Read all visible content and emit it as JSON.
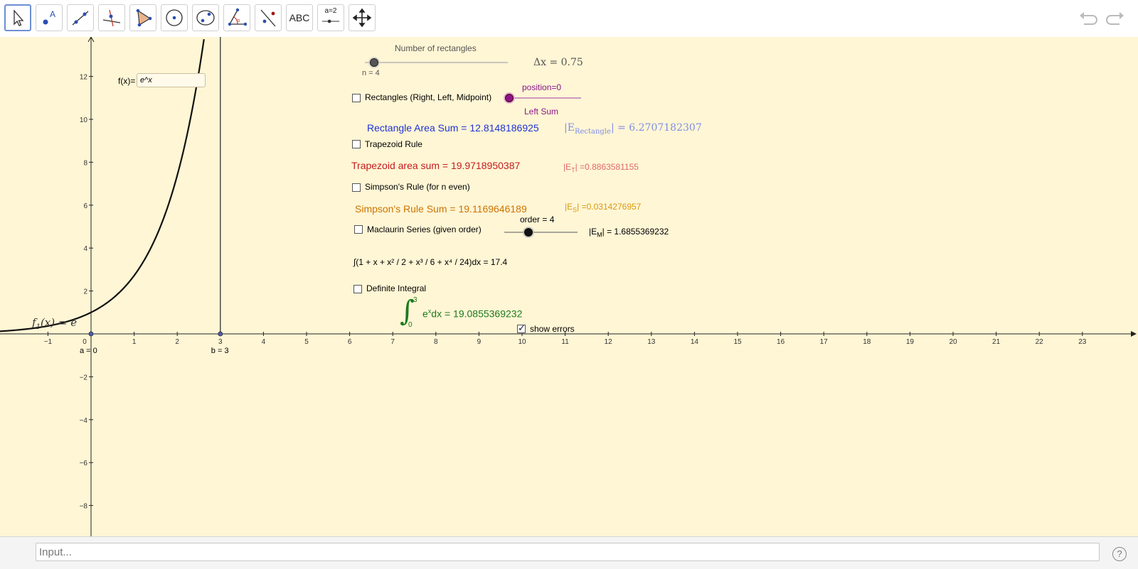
{
  "toolbar": {
    "tools": [
      "move-tool",
      "point-tool",
      "line-tool",
      "perpendicular-line-tool",
      "polygon-tool",
      "circle-tool",
      "ellipse-tool",
      "angle-tool",
      "reflect-tool",
      "text-tool",
      "slider-tool",
      "move-graphics-tool"
    ],
    "text_tool_label": "ABC",
    "slider_tool_label": "a=2"
  },
  "sliders": {
    "rectangles": {
      "title": "Number of rectangles",
      "label": "n = 4",
      "value": 4
    },
    "position": {
      "label": "position=0",
      "value": 0,
      "caption": "Left Sum"
    },
    "order": {
      "label": "order = 4",
      "value": 4
    }
  },
  "function_input": {
    "label": "f(x)=",
    "value": "e^x"
  },
  "delta": "Δx = 0.75",
  "checkboxes": {
    "rectangles": "Rectangles (Right, Left, Midpoint)",
    "trapezoid": "Trapezoid Rule",
    "simpson": "Simpson's Rule (for n even)",
    "maclaurin": "Maclaurin Series (given order)",
    "definite": "Definite Integral",
    "show_errors": "show errors"
  },
  "results": {
    "rectangle_sum": "Rectangle Area Sum = 12.8148186925",
    "rectangle_error_label": "Rectangle",
    "rectangle_error_value": "= 6.2707182307",
    "trapezoid_sum": "Trapezoid area sum = 19.9718950387",
    "trapezoid_error_label": "T",
    "trapezoid_error_value": "=0.8863581155",
    "simpson_sum": "Simpson's Rule Sum = 19.1169646189",
    "simpson_error_label": "S",
    "simpson_error_value": "=0.0314276957",
    "maclaurin_error_label": "M",
    "maclaurin_error_value": "= 1.6855369232",
    "maclaurin_integral": "∫(1 + x + x² / 2 + x³ / 6 + x⁴ / 24)dx = 17.4",
    "definite_integral_upper": "3",
    "definite_integral_lower": "0",
    "definite_integral_base": "e",
    "definite_integral_exp": "x",
    "definite_integral_tail": "dx = 19.0855369232"
  },
  "graph": {
    "function_label": "f",
    "function_label_sub": "1",
    "function_label_rest": "(x) = e",
    "point_a": "a = 0",
    "point_b": "b = 3",
    "a": 0,
    "b": 3,
    "x_ticks": [
      "−1",
      "0",
      "1",
      "2",
      "3",
      "4",
      "5",
      "6",
      "7",
      "8",
      "9",
      "10",
      "11",
      "12",
      "13",
      "14",
      "15",
      "16",
      "17",
      "18",
      "19",
      "20",
      "21",
      "22",
      "23"
    ],
    "y_ticks": [
      "12",
      "10",
      "8",
      "6",
      "4",
      "2",
      "−2",
      "−4",
      "−6",
      "−8"
    ]
  },
  "input_bar": {
    "placeholder": "Input..."
  },
  "help_label": "?"
}
